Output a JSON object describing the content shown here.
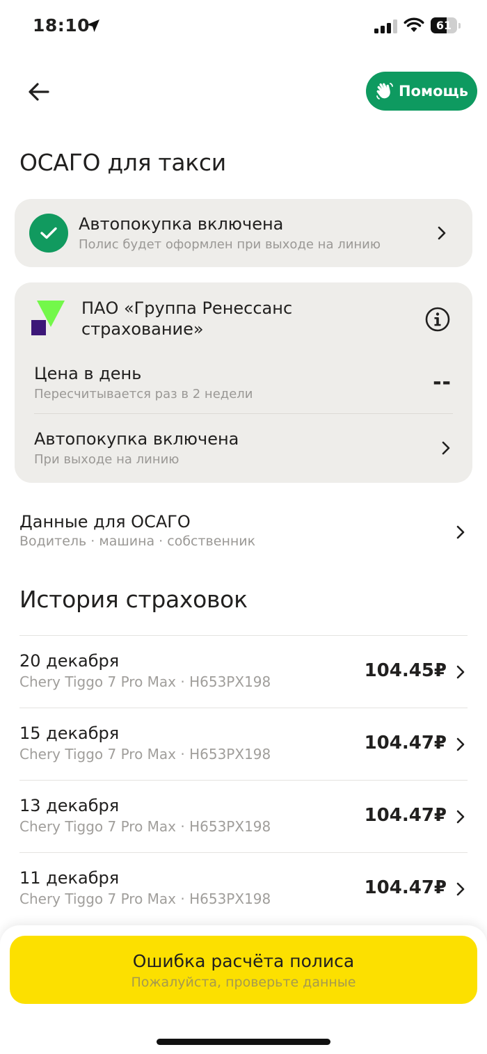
{
  "status_bar": {
    "time": "18:10",
    "battery_level": "61",
    "battery_fraction": 0.61,
    "icons": [
      "location-arrow-icon",
      "cellular-signal-icon",
      "wifi-icon",
      "battery-icon"
    ]
  },
  "header": {
    "back_icon": "arrow-left-icon",
    "help_label": "Помощь",
    "help_icon": "waving-hand-icon",
    "help_color": "#0e9a60"
  },
  "page_title": "ОСАГО для такси",
  "autobuy": {
    "title": "Автопокупка включена",
    "subtitle": "Полис будет оформлен при выходе на линию",
    "icon": "check-circle-icon",
    "status_color": "#119a5f"
  },
  "insurer": {
    "name": "ПАО «Группа Ренессанс страхование»",
    "logo": "renaissance-logo",
    "price_title": "Цена в день",
    "price_subtitle": "Пересчитывается раз в 2 недели",
    "price_value": "--",
    "autobuy_title": "Автопокупка включена",
    "autobuy_subtitle": "При выходе на линию"
  },
  "osago_data": {
    "title": "Данные для ОСАГО",
    "subtitle": "Водитель · машина · собственник"
  },
  "history": {
    "title": "История страховок",
    "items": [
      {
        "date": "20 декабря",
        "car": "Chery Tiggo 7 Pro Max · Н653РХ198",
        "price": "104.45₽"
      },
      {
        "date": "15 декабря",
        "car": "Chery Tiggo 7 Pro Max · Н653РХ198",
        "price": "104.47₽"
      },
      {
        "date": "13 декабря",
        "car": "Chery Tiggo 7 Pro Max · Н653РХ198",
        "price": "104.47₽"
      },
      {
        "date": "11 декабря",
        "car": "Chery Tiggo 7 Pro Max · Н653РХ198",
        "price": "104.47₽"
      }
    ]
  },
  "bottom": {
    "error_title": "Ошибка расчёта полиса",
    "error_subtitle": "Пожалуйста, проверьте данные",
    "button_color": "#fce000"
  }
}
